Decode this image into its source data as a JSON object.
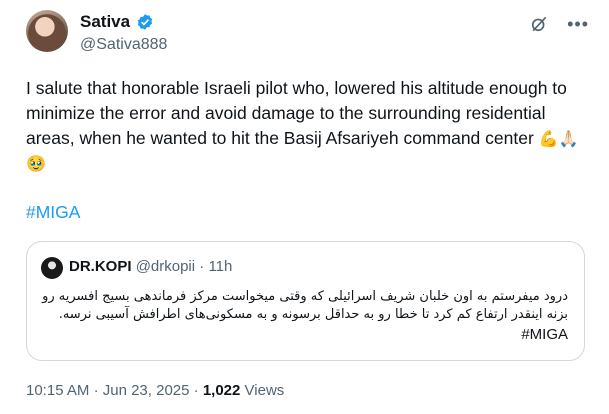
{
  "author": {
    "name": "Sativa",
    "handle": "@Sativa888"
  },
  "tweet": {
    "text": "I salute that honorable Israeli pilot who, lowered his altitude enough to minimize the error and avoid damage to the surrounding residential areas, when he wanted to hit the Basij Afsariyeh command center",
    "emojis": "💪🙏🏻🥹",
    "hashtag": "#MIGA"
  },
  "quote": {
    "name": "DR.KOPI",
    "handle": "@drkopii",
    "separator": "·",
    "time": "11h",
    "text": "درود میفرستم به اون خلبان شریف اسرائیلی که وقتی میخواست مرکز فرماندهی بسیج افسریه رو بزنه اینقدر ارتفاع کم کرد تا خطا رو به حداقل برسونه و به مسکونی‌های اطرافش آسیبی نرسه.",
    "hashtag": "#MIGA"
  },
  "footer": {
    "time": "10:15 AM",
    "separator": "·",
    "date": "Jun 23, 2025",
    "separator2": "·",
    "views_count": "1,022",
    "views_label": "Views"
  },
  "icons": {
    "verified": "verified-badge-icon",
    "grok": "grok-icon",
    "more": "more-icon"
  },
  "colors": {
    "link": "#1d9bf0",
    "secondary_text": "#536471",
    "border": "#cfd9de",
    "verified": "#1d9bf0"
  }
}
